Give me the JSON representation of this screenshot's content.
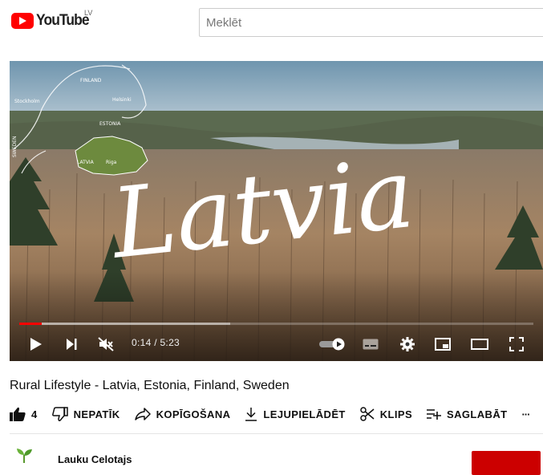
{
  "header": {
    "logo_text": "YouTube",
    "country_code": "LV",
    "search_placeholder": "Meklēt"
  },
  "player": {
    "overlay_title": "Latvia",
    "map_labels": [
      "FINLAND",
      "Helsinki",
      "Stockholm",
      "ESTONIA",
      "SWEDEN",
      "LATVIA",
      "Riga"
    ],
    "time": "0:14 / 5:23",
    "progress_fraction": 0.044,
    "buffer_fraction": 0.41,
    "icons": [
      "play-icon",
      "next-icon",
      "mute-icon",
      "autoplay-toggle-icon",
      "subtitles-icon",
      "settings-gear-icon",
      "miniplayer-icon",
      "theater-mode-icon",
      "fullscreen-icon"
    ],
    "accent_color": "#ff0000"
  },
  "video": {
    "title": "Rural Lifestyle - Latvia, Estonia, Finland, Sweden"
  },
  "actions": {
    "like_count": "4",
    "dislike_label": "NEPATĪK",
    "share_label": "KOPĪGOŠANA",
    "download_label": "LEJUPIELĀDĒT",
    "clip_label": "KLIPS",
    "save_label": "SAGLABĀT",
    "more_label": "···"
  },
  "channel": {
    "name": "Lauku Celotajs",
    "subscribe_color": "#cc0000"
  }
}
